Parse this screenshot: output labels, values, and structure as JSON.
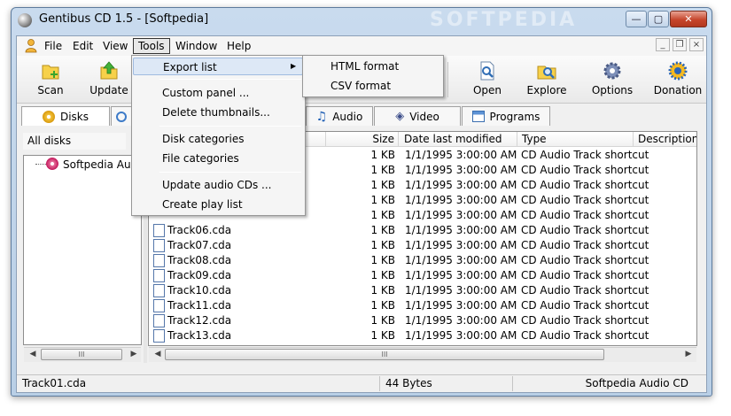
{
  "window": {
    "title": "Gentibus CD 1.5 - [Softpedia]",
    "watermark": "SOFTPEDIA",
    "controls": {
      "minimize": "—",
      "maximize": "▢",
      "close": "✕"
    },
    "mdi_controls": {
      "minimize": "_",
      "restore": "❐",
      "close": "×"
    }
  },
  "menubar": {
    "items": [
      "File",
      "Edit",
      "View",
      "Tools",
      "Window",
      "Help"
    ]
  },
  "toolbar": {
    "scan": "Scan",
    "update": "Update",
    "open": "Open",
    "explore": "Explore",
    "options": "Options",
    "donation": "Donation"
  },
  "tabs": {
    "disks": "Disks",
    "audio": "Audio",
    "video": "Video",
    "programs": "Programs"
  },
  "left_panel": {
    "header": "All disks",
    "tree_item": "Softpedia Audio",
    "scroll_grip": "III"
  },
  "file_list": {
    "columns": [
      "Size",
      "Date last modified",
      "Type",
      "Description"
    ],
    "rows": [
      {
        "name": "",
        "size": "1 KB",
        "date": "1/1/1995 3:00:00 AM",
        "type": "CD Audio Track shortcut"
      },
      {
        "name": "",
        "size": "1 KB",
        "date": "1/1/1995 3:00:00 AM",
        "type": "CD Audio Track shortcut"
      },
      {
        "name": "",
        "size": "1 KB",
        "date": "1/1/1995 3:00:00 AM",
        "type": "CD Audio Track shortcut"
      },
      {
        "name": "",
        "size": "1 KB",
        "date": "1/1/1995 3:00:00 AM",
        "type": "CD Audio Track shortcut"
      },
      {
        "name": "",
        "size": "1 KB",
        "date": "1/1/1995 3:00:00 AM",
        "type": "CD Audio Track shortcut"
      },
      {
        "name": "Track06.cda",
        "size": "1 KB",
        "date": "1/1/1995 3:00:00 AM",
        "type": "CD Audio Track shortcut"
      },
      {
        "name": "Track07.cda",
        "size": "1 KB",
        "date": "1/1/1995 3:00:00 AM",
        "type": "CD Audio Track shortcut"
      },
      {
        "name": "Track08.cda",
        "size": "1 KB",
        "date": "1/1/1995 3:00:00 AM",
        "type": "CD Audio Track shortcut"
      },
      {
        "name": "Track09.cda",
        "size": "1 KB",
        "date": "1/1/1995 3:00:00 AM",
        "type": "CD Audio Track shortcut"
      },
      {
        "name": "Track10.cda",
        "size": "1 KB",
        "date": "1/1/1995 3:00:00 AM",
        "type": "CD Audio Track shortcut"
      },
      {
        "name": "Track11.cda",
        "size": "1 KB",
        "date": "1/1/1995 3:00:00 AM",
        "type": "CD Audio Track shortcut"
      },
      {
        "name": "Track12.cda",
        "size": "1 KB",
        "date": "1/1/1995 3:00:00 AM",
        "type": "CD Audio Track shortcut"
      },
      {
        "name": "Track13.cda",
        "size": "1 KB",
        "date": "1/1/1995 3:00:00 AM",
        "type": "CD Audio Track shortcut"
      }
    ],
    "scroll_grip": "III"
  },
  "tools_menu": {
    "export_list": "Export list",
    "custom_panel": "Custom panel ...",
    "delete_thumbnails": "Delete thumbnails...",
    "disk_categories": "Disk categories",
    "file_categories": "File categories",
    "update_audio_cds": "Update audio CDs ...",
    "create_play_list": "Create play list",
    "submenu_arrow": "▶"
  },
  "export_submenu": {
    "html_format": "HTML format",
    "csv_format": "CSV format"
  },
  "statusbar": {
    "file": "Track01.cda",
    "size": "44 Bytes",
    "disk": "Softpedia Audio CD"
  }
}
